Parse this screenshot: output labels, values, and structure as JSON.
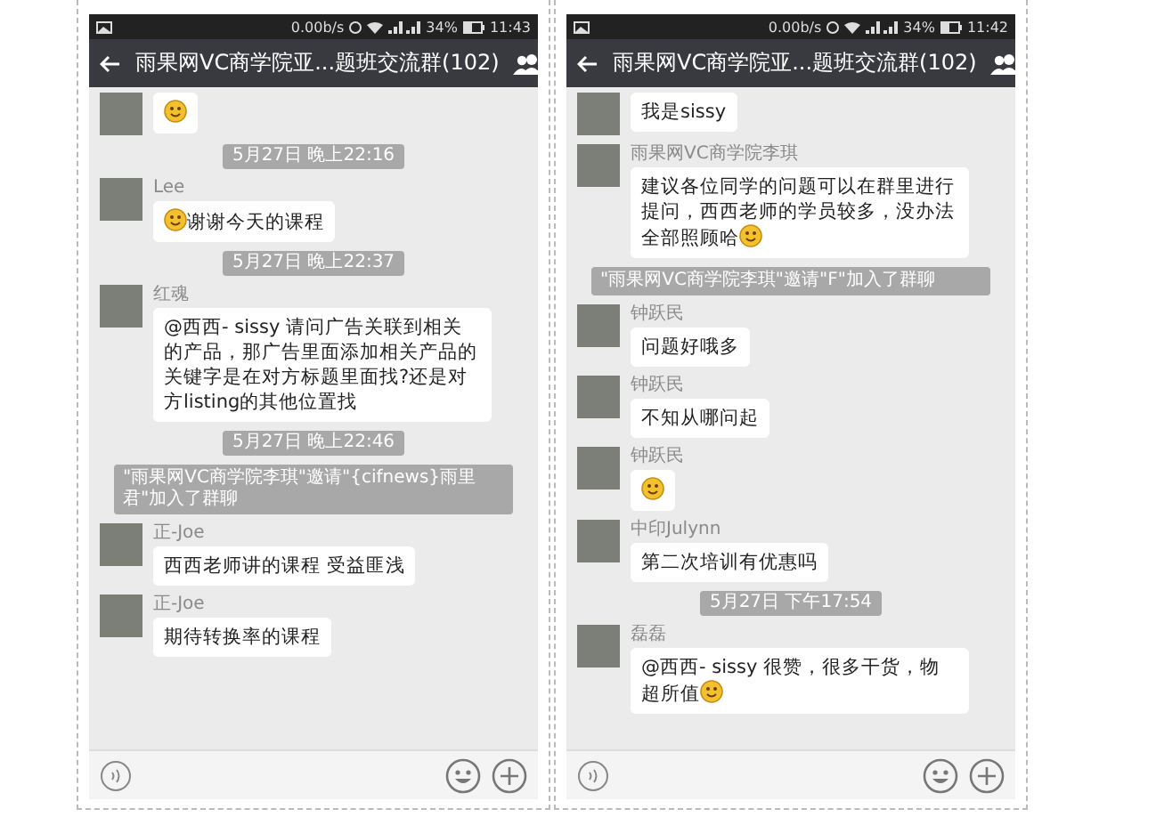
{
  "panels": [
    {
      "status_bar": {
        "speed": "0.00b/s",
        "battery": "34%",
        "time": "11:43"
      },
      "title": "雨果网VC商学院亚...题班交流群(102)",
      "messages": [
        {
          "kind": "sticker"
        },
        {
          "kind": "time",
          "text": "5月27日 晚上22:16"
        },
        {
          "kind": "message",
          "name": "Lee",
          "text": "谢谢今天的课程",
          "emoji_before": true
        },
        {
          "kind": "time",
          "text": "5月27日 晚上22:37"
        },
        {
          "kind": "message",
          "name": "红魂",
          "text": "@西西- sissy 请问广告关联到相关的产品，那广告里面添加相关产品的关键字是在对方标题里面找?还是对方listing的其他位置找"
        },
        {
          "kind": "time",
          "text": "5月27日 晚上22:46"
        },
        {
          "kind": "system",
          "text": "\"雨果网VC商学院李琪\"邀请\"{cifnews}雨里君\"加入了群聊"
        },
        {
          "kind": "message",
          "name": "正-Joe",
          "text": "西西老师讲的课程 受益匪浅"
        },
        {
          "kind": "message",
          "name": "正-Joe",
          "text": "期待转换率的课程"
        }
      ]
    },
    {
      "status_bar": {
        "speed": "0.00b/s",
        "battery": "34%",
        "time": "11:42"
      },
      "title": "雨果网VC商学院亚...题班交流群(102)",
      "messages": [
        {
          "kind": "message",
          "text": "我是sissy"
        },
        {
          "kind": "message",
          "name": "雨果网VC商学院李琪",
          "text": "建议各位同学的问题可以在群里进行提问，西西老师的学员较多，没办法全部照顾哈",
          "emoji_after": true
        },
        {
          "kind": "system",
          "text": "\"雨果网VC商学院李琪\"邀请\"F\"加入了群聊"
        },
        {
          "kind": "message",
          "name": "钟跃民",
          "text": "问题好哦多"
        },
        {
          "kind": "message",
          "name": "钟跃民",
          "text": "不知从哪问起"
        },
        {
          "kind": "sticker",
          "name": "钟跃民"
        },
        {
          "kind": "message",
          "name": "中印Julynn",
          "text": "第二次培训有优惠吗"
        },
        {
          "kind": "time",
          "text": "5月27日 下午17:54"
        },
        {
          "kind": "message",
          "name": "磊磊",
          "text": "@西西- sissy  很赞，很多干货，物超所值",
          "emoji_after": true
        }
      ]
    }
  ]
}
